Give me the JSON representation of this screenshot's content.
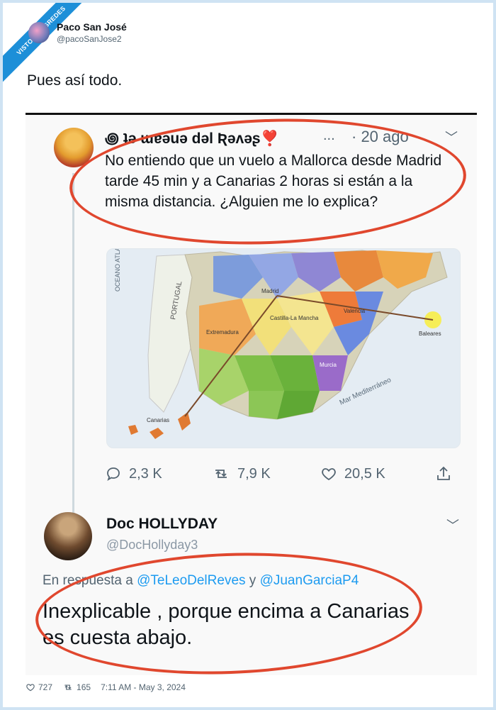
{
  "watermark": "VISTOENLASREDES",
  "author": {
    "name": "Paco San José",
    "handle": "@pacoSanJose2"
  },
  "tweet_text": "Pues así todo.",
  "embedded": {
    "original": {
      "name": "꩜ ʇǝ ɯɐǝuǝ dǝl Ʀǝʌǝʂ❣️",
      "dots": "...",
      "time": "· 20 ago",
      "text": "No entiendo que un vuelo a Mallorca desde Madrid tarde 45 min y a Canarias 2 horas si están a la misma distancia. ¿Alguien me lo explica?",
      "map": {
        "labels": [
          "OCEANO ATLANT",
          "PORTUGAL",
          "Extremadura",
          "Castilla-La Mancha",
          "Madrid",
          "Valencia",
          "Baleares",
          "Canarias",
          "Murcia",
          "Mar Mediterráneo"
        ]
      },
      "actions": {
        "replies": "2,3 K",
        "retweets": "7,9 K",
        "likes": "20,5 K"
      }
    },
    "reply": {
      "name": "Doc HOLLYDAY",
      "handle": "@DocHollyday3",
      "replying_prefix": "En respuesta a",
      "mention_1": "@TeLeoDelReves",
      "conjunction": "y",
      "mention_2": "@JuanGarciaP4",
      "text": "Inexplicable , porque encima a Canarias es cuesta abajo."
    },
    "annotation_color": "#e0472e"
  },
  "footer": {
    "likes": "727",
    "retweets": "165",
    "timestamp": "7:11 AM - May 3, 2024"
  }
}
